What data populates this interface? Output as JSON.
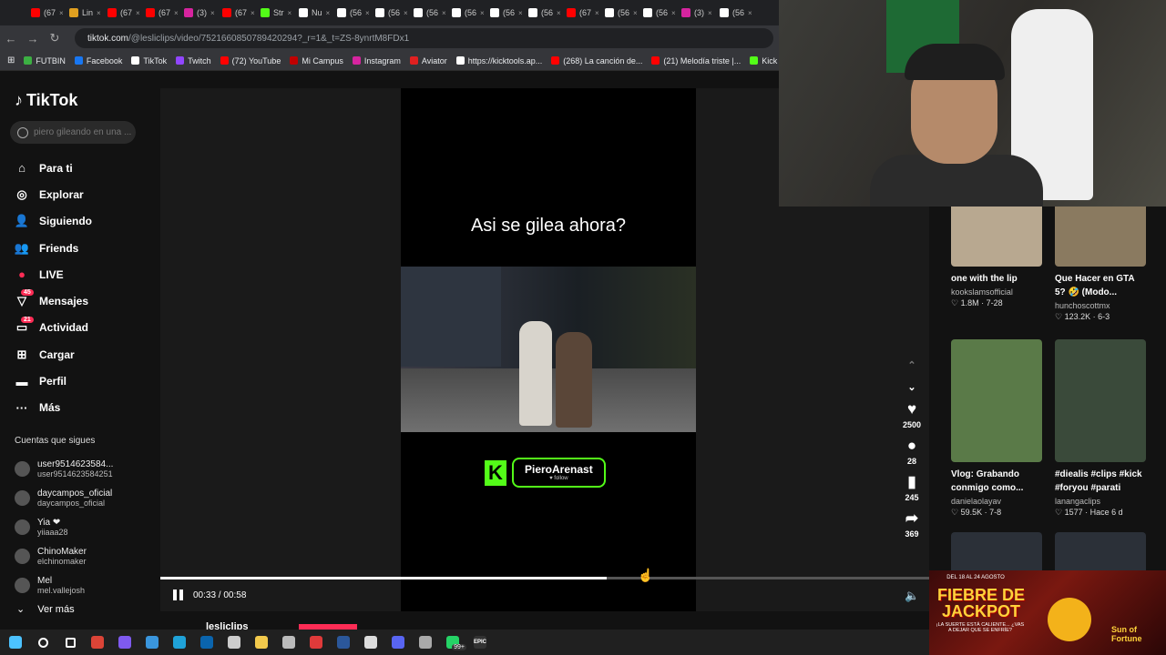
{
  "browser": {
    "tabs": [
      {
        "label": "(67",
        "color": "#ff0000"
      },
      {
        "label": "Lin",
        "color": "#e0a020"
      },
      {
        "label": "(67",
        "color": "#ff0000"
      },
      {
        "label": "(67",
        "color": "#ff0000"
      },
      {
        "label": "(3)",
        "color": "#d6249f"
      },
      {
        "label": "(67",
        "color": "#ff0000"
      },
      {
        "label": "Str",
        "color": "#53fc18"
      },
      {
        "label": "Nu",
        "color": "#ffffff"
      },
      {
        "label": "(56",
        "color": "#ffffff"
      },
      {
        "label": "(56",
        "color": "#ffffff"
      },
      {
        "label": "(56",
        "color": "#ffffff"
      },
      {
        "label": "(56",
        "color": "#ffffff"
      },
      {
        "label": "(56",
        "color": "#ffffff"
      },
      {
        "label": "(56",
        "color": "#ffffff"
      },
      {
        "label": "(67",
        "color": "#ff0000"
      },
      {
        "label": "(56",
        "color": "#ffffff"
      },
      {
        "label": "(56",
        "color": "#ffffff"
      },
      {
        "label": "(3)",
        "color": "#d6249f"
      },
      {
        "label": "(56",
        "color": "#ffffff"
      }
    ],
    "url_host": "tiktok.com",
    "url_path": "/@lesliclips/video/7521660850789420294?_r=1&_t=ZS-8ynrtM8FDx1",
    "bookmarks": [
      {
        "label": "FUTBIN",
        "color": "#3cb043"
      },
      {
        "label": "Facebook",
        "color": "#1877f2"
      },
      {
        "label": "TikTok",
        "color": "#ffffff"
      },
      {
        "label": "Twitch",
        "color": "#9146ff"
      },
      {
        "label": "(72) YouTube",
        "color": "#ff0000"
      },
      {
        "label": "Mi Campus",
        "color": "#c00000"
      },
      {
        "label": "Instagram",
        "color": "#d6249f"
      },
      {
        "label": "Aviator",
        "color": "#e02020"
      },
      {
        "label": "https://kicktools.ap...",
        "color": "#ffffff"
      },
      {
        "label": "(268) La canción de...",
        "color": "#ff0000"
      },
      {
        "label": "(21) Melodía triste |...",
        "color": "#ff0000"
      },
      {
        "label": "Kick",
        "color": "#53fc18"
      }
    ]
  },
  "sidebar": {
    "brand": "TikTok",
    "search_placeholder": "piero gileando en una ...",
    "menu": [
      {
        "label": "Para ti",
        "icon": "home-icon",
        "glyph": "⌂"
      },
      {
        "label": "Explorar",
        "icon": "compass-icon",
        "glyph": "◎"
      },
      {
        "label": "Siguiendo",
        "icon": "following-icon",
        "glyph": "👤"
      },
      {
        "label": "Friends",
        "icon": "friends-icon",
        "glyph": "👥"
      },
      {
        "label": "LIVE",
        "icon": "live-icon",
        "glyph": "●"
      },
      {
        "label": "Mensajes",
        "icon": "messages-icon",
        "glyph": "▽",
        "badge": "45"
      },
      {
        "label": "Actividad",
        "icon": "activity-icon",
        "glyph": "▭",
        "badge": "21"
      },
      {
        "label": "Cargar",
        "icon": "upload-icon",
        "glyph": "⊞"
      },
      {
        "label": "Perfil",
        "icon": "profile-icon",
        "glyph": "▬"
      },
      {
        "label": "Más",
        "icon": "more-icon",
        "glyph": "···"
      }
    ],
    "following_title": "Cuentas que sigues",
    "accounts": [
      {
        "name": "user9514623584...",
        "handle": "user9514623584251"
      },
      {
        "name": "daycampos_oficial",
        "handle": "daycampos_oficial"
      },
      {
        "name": "Yia ❤",
        "handle": "yiiaaa28"
      },
      {
        "name": "ChinoMaker",
        "handle": "elchinomaker"
      },
      {
        "name": "Mel",
        "handle": "mel.vallejosh"
      }
    ],
    "see_more": "Ver más"
  },
  "video": {
    "caption": "Asi se gilea ahora?",
    "kick_name": "PieroArenast",
    "kick_follow": "♥ follow",
    "likes": "2500",
    "comments": "28",
    "saves": "245",
    "shares": "369",
    "time": "00:33 / 00:58",
    "progress": 0.58,
    "author": "lesliclips"
  },
  "grid": [
    {
      "title": "one with the lip",
      "user": "kookslamsofficial",
      "stats": "♡ 1.8M · 7-28",
      "color": "#b8a890"
    },
    {
      "title": "Que Hacer en GTA 5? 🤣 (Modo...",
      "user": "hunchoscottmx",
      "stats": "♡ 123.2K · 6-3",
      "color": "#8a7a60"
    },
    {
      "title": "Vlog: Grabando conmigo como...",
      "user": "danielaolayav",
      "stats": "♡ 59.5K · 7-8",
      "color": "#5a7a48"
    },
    {
      "title": "#diealis #clips #kick #foryou #parati",
      "user": "lanangaclips",
      "stats": "♡ 1577 · Hace 6 d",
      "color": "#3a4a3a"
    }
  ],
  "ad": {
    "date": "DEL 18 AL 24 AGOSTO",
    "title": "FIEBRE DE JACKPOT",
    "tagline": "¡LA SUERTE ESTÁ CALIENTE... ¿VAS A DEJAR QUE SE ENFRÍE?",
    "brand": "Sun of Fortune"
  },
  "taskbar": {
    "items": [
      {
        "icon": "windows-icon",
        "color": "#4cc2ff"
      },
      {
        "icon": "search-icon",
        "color": "#ffffff"
      },
      {
        "icon": "task-view-icon",
        "color": "#ffffff"
      },
      {
        "icon": "chrome-icon",
        "color": "#db4437"
      },
      {
        "icon": "copilot-icon",
        "color": "#7f5af0"
      },
      {
        "icon": "store-icon",
        "color": "#3a96dd"
      },
      {
        "icon": "edge-icon",
        "color": "#1fa2d8"
      },
      {
        "icon": "outlook-icon",
        "color": "#0a64ad"
      },
      {
        "icon": "obs-icon",
        "color": "#cccccc"
      },
      {
        "icon": "folder-icon",
        "color": "#f2c94c"
      },
      {
        "icon": "game-icon",
        "color": "#bbbbbb"
      },
      {
        "icon": "app-red-icon",
        "color": "#e03a3a"
      },
      {
        "icon": "word-icon",
        "color": "#2b579a"
      },
      {
        "icon": "c-icon",
        "color": "#dddddd"
      },
      {
        "icon": "discord-icon",
        "color": "#5865f2"
      },
      {
        "icon": "steam-icon",
        "color": "#aaaaaa"
      },
      {
        "icon": "whatsapp-icon",
        "color": "#25d366"
      },
      {
        "icon": "epic-icon",
        "color": "#dddddd"
      }
    ],
    "whatsapp_badge": "99+",
    "epic_label": "EPIC"
  }
}
